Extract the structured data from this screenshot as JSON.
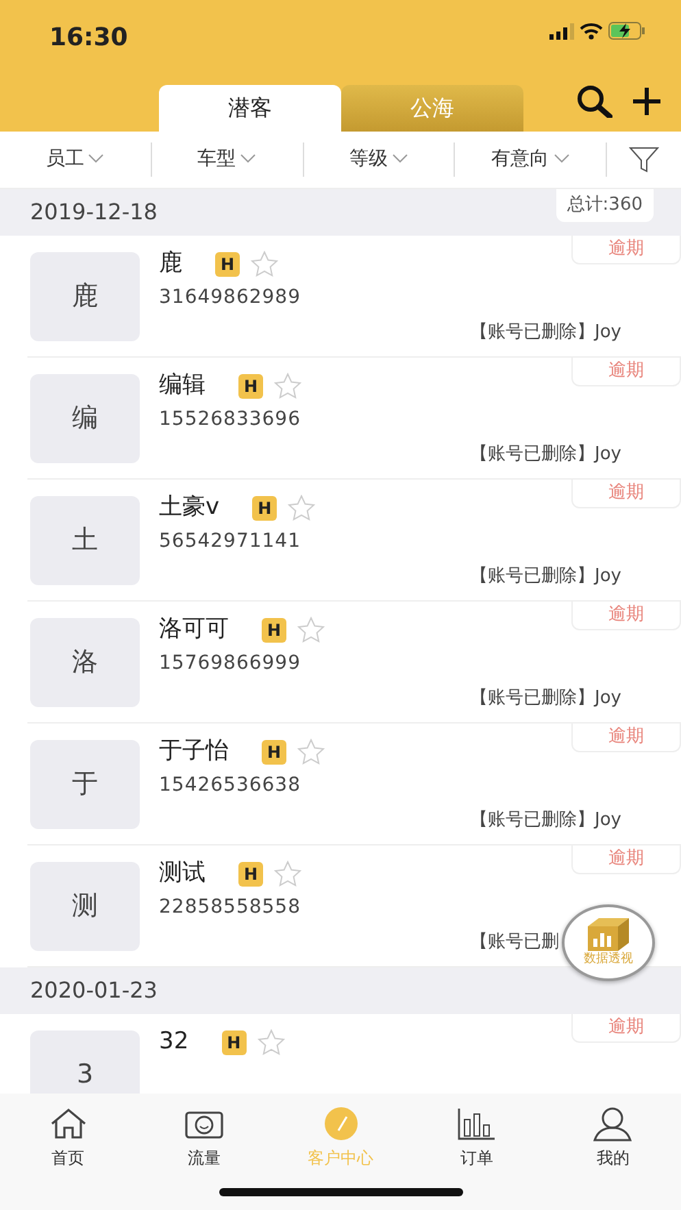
{
  "status_bar": {
    "time": "16:30"
  },
  "tabs": [
    {
      "label": "潜客",
      "selected": true
    },
    {
      "label": "公海",
      "selected": false
    }
  ],
  "filters": [
    {
      "label": "员工"
    },
    {
      "label": "车型"
    },
    {
      "label": "等级"
    },
    {
      "label": "有意向"
    }
  ],
  "total": "总计:360",
  "groups": [
    {
      "date": "2019-12-18",
      "customers": [
        {
          "avatar": "鹿",
          "name": "鹿",
          "level": "H",
          "starred": false,
          "phone": "31649862989",
          "owner": "【账号已删除】Joy",
          "tag": "逾期"
        },
        {
          "avatar": "编",
          "name": "编辑",
          "level": "H",
          "starred": false,
          "phone": "15526833696",
          "owner": "【账号已删除】Joy",
          "tag": "逾期"
        },
        {
          "avatar": "土",
          "name": "土豪v",
          "level": "H",
          "starred": false,
          "phone": "56542971141",
          "owner": "【账号已删除】Joy",
          "tag": "逾期"
        },
        {
          "avatar": "洛",
          "name": "洛可可",
          "level": "H",
          "starred": false,
          "phone": "15769866999",
          "owner": "【账号已删除】Joy",
          "tag": "逾期"
        },
        {
          "avatar": "于",
          "name": "于子怡",
          "level": "H",
          "starred": false,
          "phone": "15426536638",
          "owner": "【账号已删除】Joy",
          "tag": "逾期"
        },
        {
          "avatar": "测",
          "name": "测试",
          "level": "H",
          "starred": false,
          "phone": "22858558558",
          "owner": "【账号已删",
          "tag": "逾期"
        }
      ]
    },
    {
      "date": "2020-01-23",
      "customers": [
        {
          "avatar": "3",
          "name": "32",
          "level": "H",
          "starred": false,
          "tag": "逾期"
        }
      ]
    }
  ],
  "float_button": {
    "label": "数据透视"
  },
  "bottom_nav": [
    {
      "label": "首页",
      "selected": false
    },
    {
      "label": "流量",
      "selected": false
    },
    {
      "label": "客户中心",
      "selected": true
    },
    {
      "label": "订单",
      "selected": false
    },
    {
      "label": "我的",
      "selected": false
    }
  ]
}
